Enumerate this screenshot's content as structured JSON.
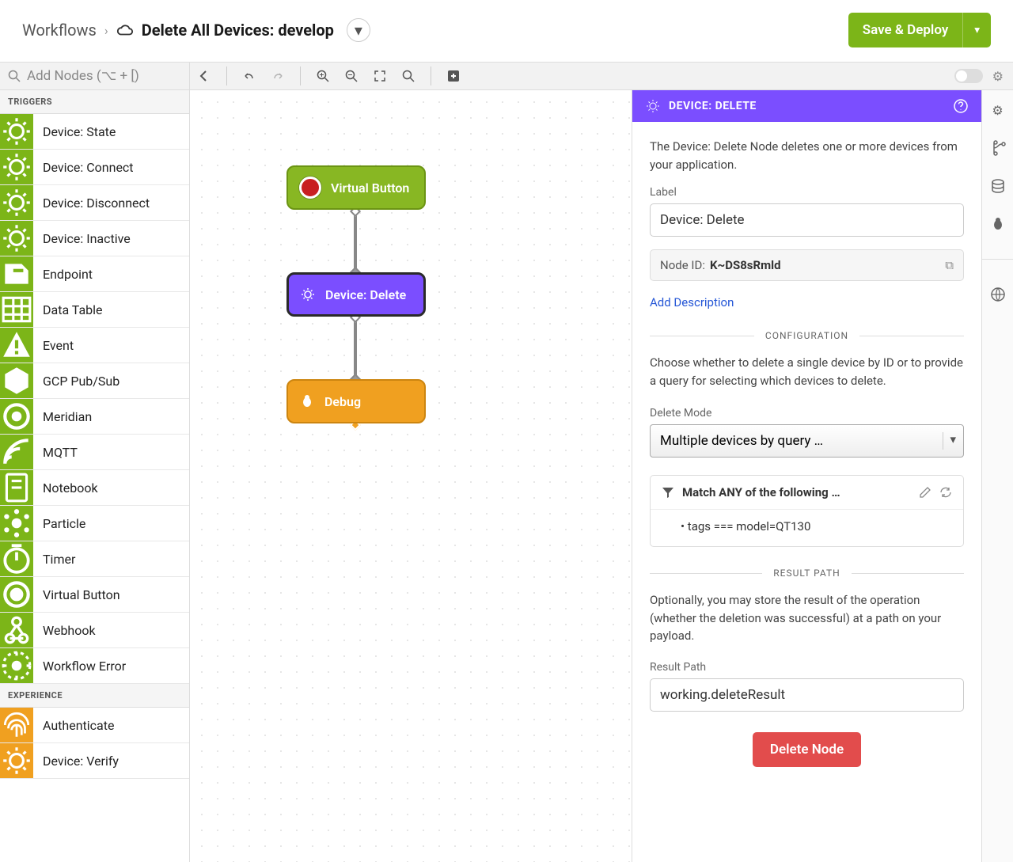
{
  "breadcrumb": {
    "root": "Workflows",
    "title": "Delete All Devices: develop"
  },
  "toolbar": {
    "save_label": "Save & Deploy",
    "add_nodes_placeholder": "Add Nodes (⌥ + [)"
  },
  "sidebar": {
    "section_triggers": "TRIGGERS",
    "section_experience": "EXPERIENCE",
    "triggers": [
      {
        "label": "Device: State",
        "icon": "device"
      },
      {
        "label": "Device: Connect",
        "icon": "device"
      },
      {
        "label": "Device: Disconnect",
        "icon": "device"
      },
      {
        "label": "Device: Inactive",
        "icon": "device"
      },
      {
        "label": "Endpoint",
        "icon": "endpoint"
      },
      {
        "label": "Data Table",
        "icon": "table"
      },
      {
        "label": "Event",
        "icon": "event"
      },
      {
        "label": "GCP Pub/Sub",
        "icon": "hub"
      },
      {
        "label": "Meridian",
        "icon": "meridian"
      },
      {
        "label": "MQTT",
        "icon": "mqtt"
      },
      {
        "label": "Notebook",
        "icon": "notebook"
      },
      {
        "label": "Particle",
        "icon": "particle"
      },
      {
        "label": "Timer",
        "icon": "timer"
      },
      {
        "label": "Virtual Button",
        "icon": "vbutton"
      },
      {
        "label": "Webhook",
        "icon": "webhook"
      },
      {
        "label": "Workflow Error",
        "icon": "error"
      }
    ],
    "experience": [
      {
        "label": "Authenticate",
        "icon": "fingerprint"
      },
      {
        "label": "Device: Verify",
        "icon": "device"
      }
    ]
  },
  "canvas": {
    "nodes": {
      "vb_label": "Virtual Button",
      "dd_label": "Device: Delete",
      "dbg_label": "Debug"
    }
  },
  "panel": {
    "header_title": "DEVICE: DELETE",
    "description": "The Device: Delete Node deletes one or more devices from your application.",
    "label_label": "Label",
    "label_value": "Device: Delete",
    "node_id_label": "Node ID:",
    "node_id_value": "K~DS8sRmld",
    "add_description": "Add Description",
    "section_config": "CONFIGURATION",
    "config_desc": "Choose whether to delete a single device by ID or to provide a query for selecting which devices to delete.",
    "delete_mode_label": "Delete Mode",
    "delete_mode_value": "Multiple devices by query …",
    "match_title": "Match ANY of the following …",
    "match_rule": "tags === model=QT130",
    "section_result": "RESULT PATH",
    "result_desc": "Optionally, you may store the result of the operation (whether the deletion was successful) at a path on your payload.",
    "result_path_label": "Result Path",
    "result_path_value": "working.deleteResult",
    "delete_button": "Delete Node"
  }
}
